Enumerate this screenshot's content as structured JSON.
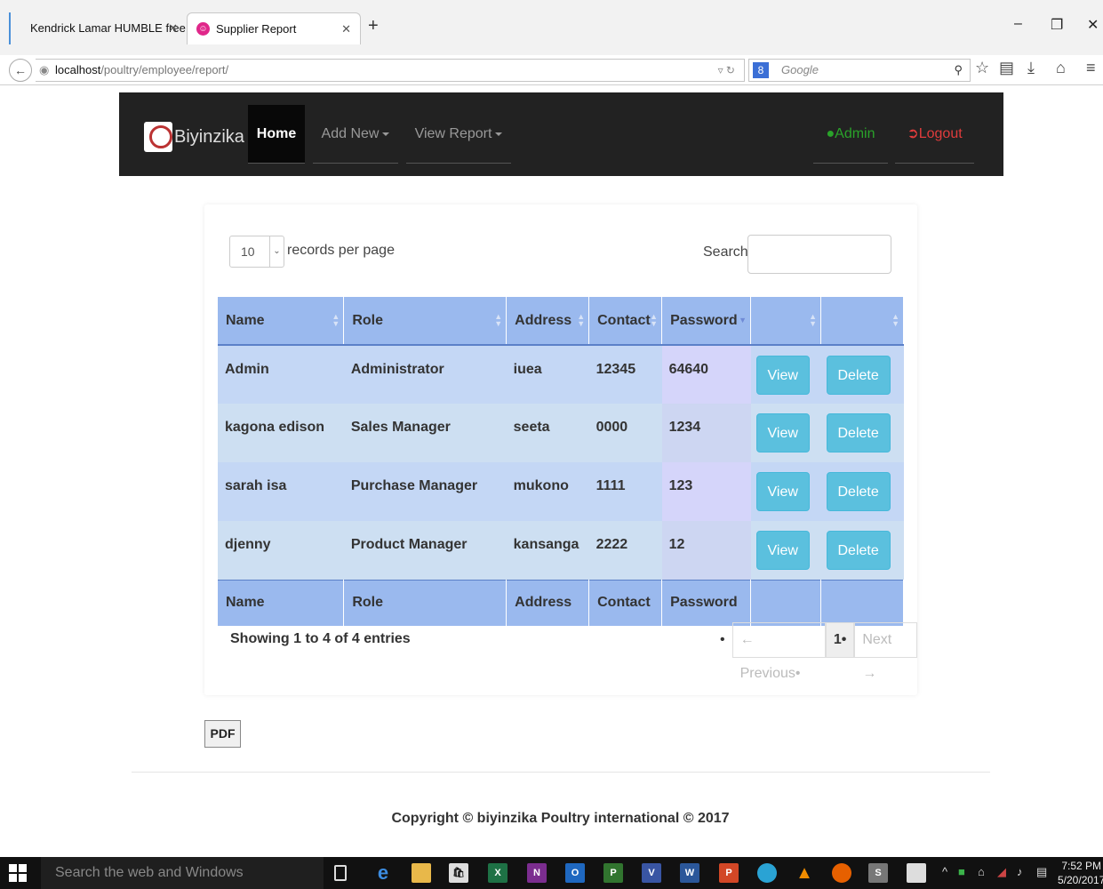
{
  "browser": {
    "tabs": [
      {
        "title": "Kendrick Lamar HUMBLE free ..."
      },
      {
        "title": "Supplier Report"
      }
    ],
    "url_host": "localhost",
    "url_path": "/poultry/employee/report/",
    "search_placeholder": "Google"
  },
  "app": {
    "brand": "Biyinzika",
    "nav": {
      "home": "Home",
      "add_new": "Add New",
      "view_report": "View Report",
      "admin": "Admin",
      "logout": "Logout"
    }
  },
  "table_controls": {
    "page_length": "10",
    "length_label": "records per page",
    "search_label": "Search:",
    "search_value": ""
  },
  "table": {
    "headers": [
      "Name",
      "Role",
      "Address",
      "Contact",
      "Password",
      "",
      ""
    ],
    "sorted_column": "Password",
    "rows": [
      {
        "name": "Admin",
        "role": "Administrator",
        "address": "iuea",
        "contact": "12345",
        "password": "64640"
      },
      {
        "name": "kagona edison",
        "role": "Sales Manager",
        "address": "seeta",
        "contact": "0000",
        "password": "1234"
      },
      {
        "name": "sarah isa",
        "role": "Purchase Manager",
        "address": "mukono",
        "contact": "1111",
        "password": "123"
      },
      {
        "name": "djenny",
        "role": "Product Manager",
        "address": "kansanga",
        "contact": "2222",
        "password": "12"
      }
    ],
    "view_label": "View",
    "delete_label": "Delete"
  },
  "pagination": {
    "info": "Showing 1 to 4 of 4 entries",
    "previous": "← Previous",
    "current": "1",
    "next": "Next →"
  },
  "pdf_label": "PDF",
  "footer": {
    "copyright": "Copyright © biyinzika Poultry international © 2017"
  },
  "taskbar": {
    "search_placeholder": "Search the web and Windows",
    "time": "7:52 PM",
    "date": "5/20/2017"
  },
  "colors": {
    "header_bg": "#9ab9ee",
    "row_odd": "#c4d7f5",
    "row_even": "#cddff2",
    "btn_info": "#5bc0de",
    "nav_bg": "#222222",
    "admin_green": "#2aa32a",
    "logout_red": "#e03c3c"
  }
}
